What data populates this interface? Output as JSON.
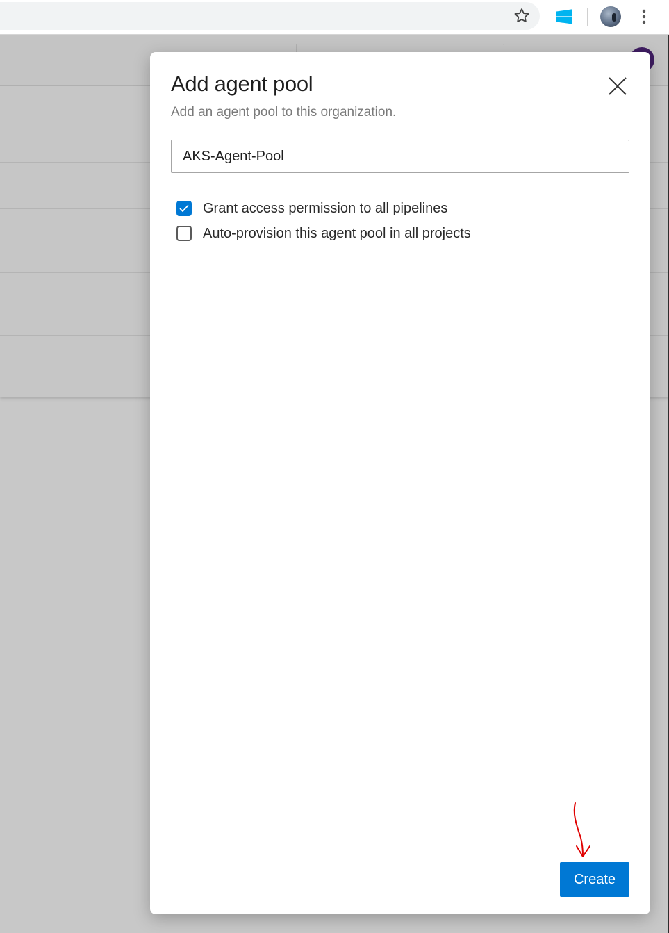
{
  "dialog": {
    "title": "Add agent pool",
    "subtitle": "Add an agent pool to this organization.",
    "name_input": {
      "value": "AKS-Agent-Pool"
    },
    "options": [
      {
        "label": "Grant access permission to all pipelines",
        "checked": true
      },
      {
        "label": "Auto-provision this agent pool in all projects",
        "checked": false
      }
    ],
    "create_label": "Create",
    "close_icon": "close-icon"
  },
  "browser_toolbar": {
    "icons": [
      "star-icon",
      "windows-icon",
      "profile-avatar",
      "menu-icon"
    ]
  },
  "annotation": {
    "arrow_color": "#e00000"
  },
  "colors": {
    "accent": "#0078d4",
    "overlay": "#c8c8c8"
  }
}
